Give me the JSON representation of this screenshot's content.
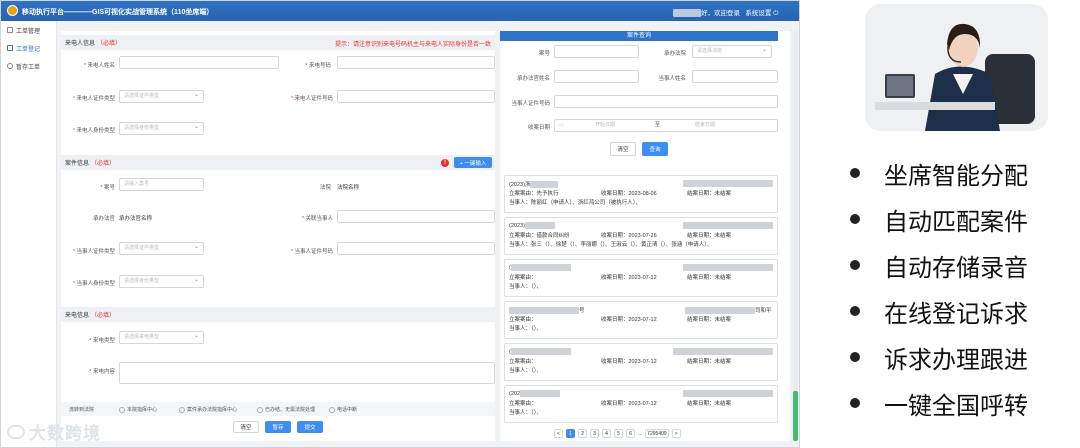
{
  "app": {
    "title": "移动执行平台————GIS可视化实战管理系统（110坐席端）",
    "user_suffix": "好，欢迎登录",
    "settings": "系统设置"
  },
  "sidebar": {
    "items": [
      {
        "label": "工单管理"
      },
      {
        "label": "工单登记"
      },
      {
        "label": "暂存工单"
      }
    ]
  },
  "form": {
    "caller_section": {
      "title": "来电人信息",
      "required": "（必填）",
      "hint": "提示：请注意识别来电号码机主与来电人实际身份是否一致"
    },
    "caller_name_label": "来电人姓名",
    "caller_phone_label": "来电号码",
    "caller_cert_type_label": "来电人证件类型",
    "caller_cert_type_placeholder": "请选择证件类型",
    "caller_cert_no_label": "来电人证件号码",
    "caller_identity_label": "来电人身份类型",
    "caller_identity_placeholder": "请选择身份类型",
    "case_section": {
      "title": "案件信息",
      "required": "（必填）",
      "add_button": "+ 一键输入"
    },
    "case_no_label": "案号",
    "case_no_placeholder": "请输入案号",
    "court_label": "法院",
    "court_value": "法院名称",
    "undertaker_label": "承办法官",
    "undertaker_value": "承办法官名称",
    "related_party_label": "关联当事人",
    "party_cert_type_label": "当事人证件类型",
    "party_cert_type_placeholder": "请选择证件类型",
    "party_cert_no_label": "当事人证件号码",
    "party_identity_label": "当事人身份类型",
    "party_identity_placeholder": "请选择身份类型",
    "call_section": {
      "title": "来电信息",
      "required": "（必填）"
    },
    "call_type_label": "来电类型",
    "call_type_placeholder": "请选择来电类型",
    "call_content_label": "来电内容",
    "flow": {
      "label": "流转到法院",
      "options": [
        "本院指挥中心",
        "案件承办法院指挥中心",
        "已办结、无需法院处理",
        "电话中断"
      ]
    },
    "buttons": {
      "clear": "清空",
      "save_draft": "暂存",
      "submit": "提交"
    }
  },
  "query": {
    "title": "案件查询",
    "case_no_label": "案号",
    "court_label": "承办法院",
    "court_placeholder": "请选择法院",
    "undertaker_label": "承办法官姓名",
    "party_name_label": "当事人姓名",
    "party_cert_label": "当事人证件号码",
    "closing_date_label": "收案日期",
    "start_placeholder": "开始日期",
    "to_label": "至",
    "end_placeholder": "结束日期",
    "clear_button": "清空",
    "search_button": "查询"
  },
  "results": [
    {
      "l1": "(2023)浙",
      "cause": "立案案由：先予执行",
      "date": "收案日期：2023-08-06",
      "status": "结案日期：未结案",
      "parties": "当事人：陈丽红（申请人）、浙红鸿公司（被执行人）、"
    },
    {
      "l1": "(2023)",
      "cause": "立案案由：借款合同纠纷",
      "date": "收案日期：2023-07-26",
      "status": "结案日期：未结案",
      "parties": "当事人：张三（）、徐楚（）、李丽娜（）、王淑云（）、黄正清（）、张涵（申请人）、"
    },
    {
      "l1": "(",
      "cause": "立案案由：",
      "date": "收案日期：2023-07-12",
      "status": "结案日期：未结案",
      "parties": "当事人：（）、"
    },
    {
      "l1": "",
      "l1_extra": "号",
      "right_extra": "司和平",
      "cause": "立案案由：",
      "date": "收案日期：2023-07-12",
      "status": "结案日期：未结案",
      "parties": "当事人：（）、"
    },
    {
      "l1": "(",
      "cause": "立案案由：",
      "date": "收案日期：2023-07-12",
      "status": "结案日期：未结案",
      "parties": "当事人：（）、"
    },
    {
      "l1": "(202",
      "cause": "立案案由：",
      "date": "收案日期：2023-07-12",
      "status": "结案日期：未结案",
      "parties": "当事人：（）、"
    }
  ],
  "pager": {
    "prev": "<",
    "pages": [
      "1",
      "2",
      "3",
      "4",
      "5",
      "6"
    ],
    "ellipsis": "...",
    "last": "7295409",
    "next": ">",
    "current": "1"
  },
  "watermark": "大数跨境",
  "features": [
    "坐席智能分配",
    "自动匹配案件",
    "自动存储录音",
    "在线登记诉求",
    "诉求办理跟进",
    "一键全国呼转"
  ],
  "colors": {
    "primary": "#2f73c6",
    "button": "#3d8ef0",
    "required": "#e6322e",
    "scroll": "#3fbf6f"
  }
}
